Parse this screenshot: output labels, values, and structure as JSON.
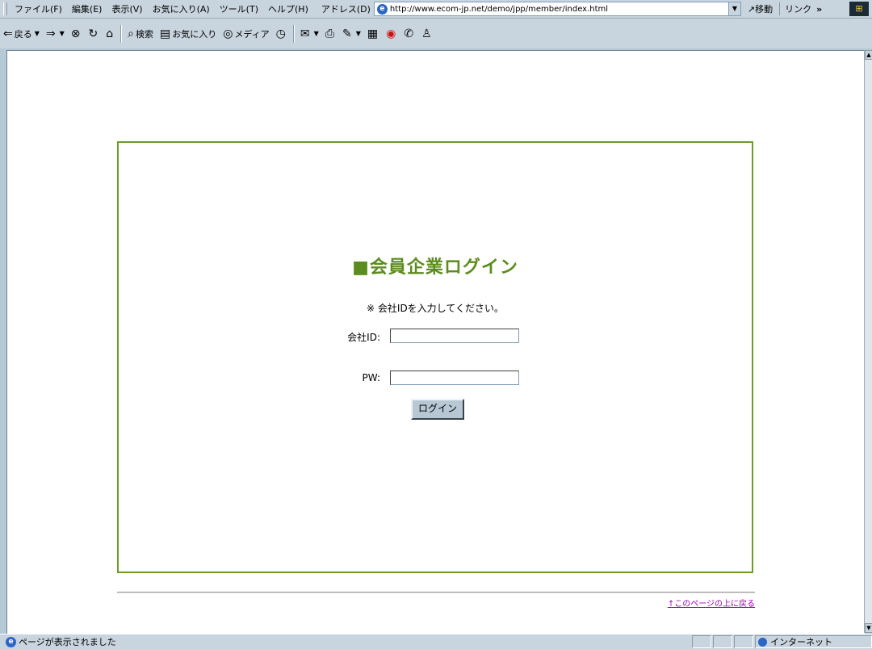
{
  "menubar": {
    "items": [
      "ファイル(F)",
      "編集(E)",
      "表示(V)",
      "お気に入り(A)",
      "ツール(T)",
      "ヘルプ(H)"
    ],
    "address_label": "アドレス(D)",
    "address_value": "http://www.ecom-jp.net/demo/jpp/member/index.html",
    "go_label": "移動",
    "links_label": "リンク",
    "overflow": "»"
  },
  "toolbar": {
    "back_label": "戻る",
    "search_label": "検索",
    "favorites_label": "お気に入り",
    "media_label": "メディア"
  },
  "login": {
    "title": "■会員企業ログイン",
    "note": "※ 会社IDを入力してください。",
    "company_id_label": "会社ID:",
    "company_id_value": "",
    "password_label": "PW:",
    "password_value": "",
    "submit_label": "ログイン"
  },
  "footer": {
    "back_to_top": "↑このページの上に戻る"
  },
  "status": {
    "message": "ページが表示されました",
    "zone": "インターネット"
  }
}
